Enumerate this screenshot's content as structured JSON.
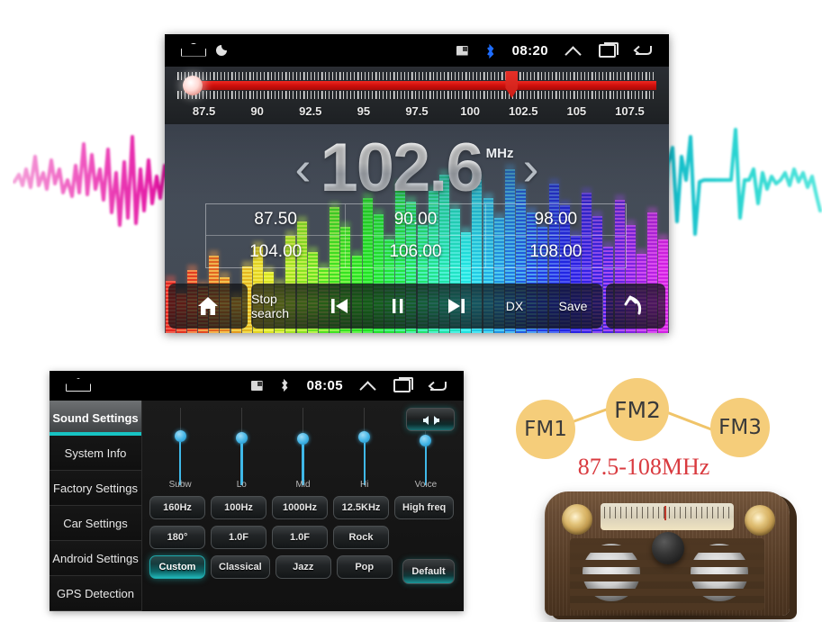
{
  "radio": {
    "status_bar": {
      "home_icon": "home-outline-icon",
      "app_icon": "circle-dot-icon",
      "sd_icon": "sd-card-icon",
      "bluetooth_icon": "bluetooth-icon",
      "time": "08:20",
      "expand_icon": "chevron-up-icon",
      "recents_icon": "recents-icon",
      "back_icon": "back-arrow-icon"
    },
    "tuner": {
      "scale_labels": [
        "87.5",
        "90",
        "92.5",
        "95",
        "97.5",
        "100",
        "102.5",
        "105",
        "107.5"
      ],
      "thumb_position_pct": 68.5,
      "band_min": 87.5,
      "band_max": 108.0
    },
    "display": {
      "prev_chevron": "‹",
      "frequency": "102.6",
      "unit": "MHz",
      "next_chevron": "›"
    },
    "presets": [
      "87.50",
      "90.00",
      "98.00",
      "104.00",
      "106.00",
      "108.00"
    ],
    "toolbar": {
      "home_icon": "home-filled-icon",
      "stop_search": "Stop search",
      "prev_icon": "skip-previous-icon",
      "pause_icon": "pause-icon",
      "next_icon": "skip-next-icon",
      "dx": "DX",
      "save": "Save",
      "back_icon": "back-curved-arrow-icon"
    },
    "colors": {
      "tuner_bar": "#d41a14",
      "accent": "#17c3c3"
    }
  },
  "settings": {
    "status_bar": {
      "home_icon": "home-outline-icon",
      "sd_icon": "sd-card-icon",
      "bluetooth_icon": "bluetooth-icon",
      "time": "08:05",
      "expand_icon": "chevron-up-icon",
      "recents_icon": "recents-icon",
      "back_icon": "back-arrow-icon"
    },
    "sidebar": [
      {
        "label": "Sound Settings",
        "active": true
      },
      {
        "label": "System Info",
        "active": false
      },
      {
        "label": "Factory Settings",
        "active": false
      },
      {
        "label": "Car Settings",
        "active": false
      },
      {
        "label": "Android Settings",
        "active": false
      },
      {
        "label": "GPS Detection",
        "active": false
      }
    ],
    "sliders": [
      {
        "label": "Subw",
        "value_pct": 30
      },
      {
        "label": "Lo",
        "value_pct": 32
      },
      {
        "label": "Mid",
        "value_pct": 33
      },
      {
        "label": "Hi",
        "value_pct": 31
      },
      {
        "label": "Voice",
        "value_pct": 36
      }
    ],
    "balance_button": "balance-fader-icon",
    "freq_row": [
      "160Hz",
      "100Hz",
      "1000Hz",
      "12.5KHz",
      "High freq"
    ],
    "param_row": [
      "180°",
      "1.0F",
      "1.0F",
      "Rock"
    ],
    "preset_row": [
      {
        "label": "Custom",
        "active": true
      },
      {
        "label": "Classical",
        "active": false
      },
      {
        "label": "Jazz",
        "active": false
      },
      {
        "label": "Pop",
        "active": false
      }
    ],
    "default_button": "Default",
    "colors": {
      "accent": "#17c3c3",
      "slider": "#3fb8e8"
    }
  },
  "fm_graphic": {
    "nodes": [
      "FM1",
      "FM2",
      "FM3"
    ],
    "range_text": "87.5-108MHz",
    "colors": {
      "node": "#f5cd7a",
      "range_text": "#d93a3f"
    }
  },
  "retro_radio": {
    "name": "retro-wooden-radio",
    "colors": {
      "wood": "#5b4029",
      "knob": "#d9b364",
      "dial": "#e8e2d0"
    }
  },
  "decorations": {
    "left_waveform": {
      "name": "pink-waveform",
      "color": "#e832b4"
    },
    "right_waveform": {
      "name": "cyan-waveform",
      "color": "#25d4d4"
    }
  }
}
